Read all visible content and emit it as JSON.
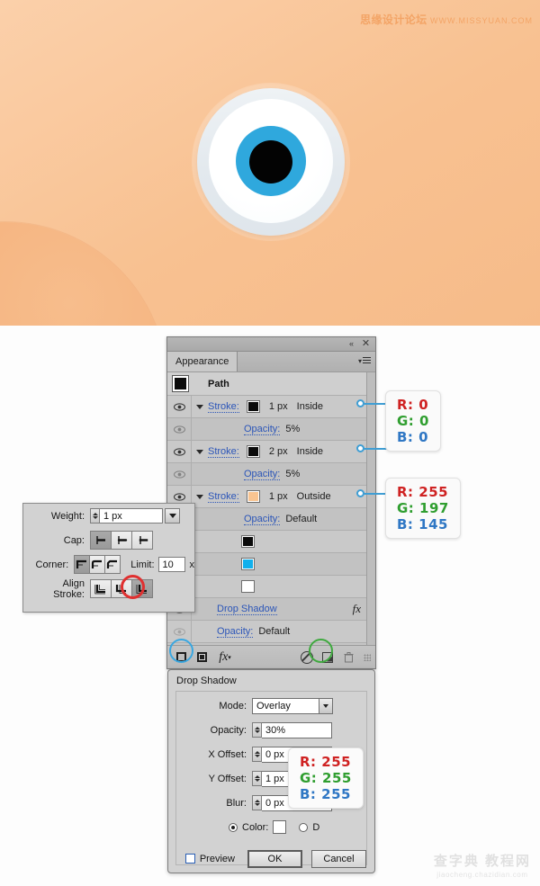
{
  "artboard": {
    "background_color": "#f8c191",
    "eye": {
      "ring_color": "#e6ecf1",
      "white_color": "#ffffff",
      "iris_color": "#2fa8dd",
      "pupil_color": "#030303"
    },
    "watermark_cn": "思缘设计论坛",
    "watermark_url": "WWW.MISSYUAN.COM"
  },
  "appearance_panel": {
    "tab_label": "Appearance",
    "collapse_icon": "«",
    "close_icon": "✕",
    "menu_icon": "panel-menu-icon",
    "header": {
      "label": "Path",
      "thumb_color": "#0b0b0b"
    },
    "rows": [
      {
        "type": "stroke",
        "label": "Stroke:",
        "swatch": "#0b0b0b",
        "weight": "1 px",
        "align": "Inside"
      },
      {
        "type": "opacity",
        "label": "Opacity:",
        "value": "5%"
      },
      {
        "type": "stroke",
        "label": "Stroke:",
        "swatch": "#0b0b0b",
        "weight": "2 px",
        "align": "Inside"
      },
      {
        "type": "opacity",
        "label": "Opacity:",
        "value": "5%"
      },
      {
        "type": "stroke",
        "label": "Stroke:",
        "swatch": "#f9c491",
        "weight": "1 px",
        "align": "Outside"
      },
      {
        "type": "opacity",
        "label": "Opacity:",
        "value": "Default"
      },
      {
        "type": "swatch",
        "swatch": "#0b0b0b"
      },
      {
        "type": "swatch",
        "swatch": "#11b0ec"
      },
      {
        "type": "swatch",
        "swatch": "#ffffff"
      },
      {
        "type": "effect",
        "label": "Drop Shadow",
        "fx": "fx"
      },
      {
        "type": "opacity",
        "label": "Opacity:",
        "value": "Default"
      }
    ],
    "footer": {
      "add_new_stroke": "add-new-stroke-button",
      "add_new_fill": "add-new-fill-button",
      "add_effect": "fx",
      "clear_appearance": "clear-appearance-button",
      "duplicate_item": "duplicate-item-button",
      "delete_item": "delete-item-button"
    }
  },
  "stroke_options": {
    "weight": {
      "label": "Weight:",
      "value": "1 px"
    },
    "cap": {
      "label": "Cap:",
      "options": [
        "butt-cap",
        "round-cap",
        "projecting-cap"
      ],
      "selected": 0
    },
    "corner": {
      "label": "Corner:",
      "options": [
        "miter-join",
        "round-join",
        "bevel-join"
      ],
      "selected": 0
    },
    "limit": {
      "label": "Limit:",
      "value": "10",
      "unit": "x"
    },
    "align_stroke": {
      "label": "Align Stroke:",
      "options": [
        "align-center",
        "align-inside",
        "align-outside"
      ],
      "selected": 2
    }
  },
  "drop_shadow": {
    "title": "Drop Shadow",
    "mode": {
      "label": "Mode:",
      "value": "Overlay"
    },
    "opacity": {
      "label": "Opacity:",
      "value": "30%"
    },
    "x_offset": {
      "label": "X Offset:",
      "value": "0 px"
    },
    "y_offset": {
      "label": "Y Offset:",
      "value": "1 px"
    },
    "blur": {
      "label": "Blur:",
      "value": "0 px"
    },
    "color_radio": "Color:",
    "darkness_radio": "D",
    "preview": "Preview",
    "ok": "OK",
    "cancel": "Cancel"
  },
  "callouts": {
    "black": {
      "r": "R: 0",
      "g": "G: 0",
      "b": "B: 0"
    },
    "skin": {
      "r": "R: 255",
      "g": "G: 197",
      "b": "B: 145"
    },
    "white": {
      "r": "R: 255",
      "g": "G: 255",
      "b": "B: 255"
    }
  },
  "footer_watermark": {
    "cn": "查字典 教程网",
    "url": "jiaocheng.chazidian.com"
  }
}
